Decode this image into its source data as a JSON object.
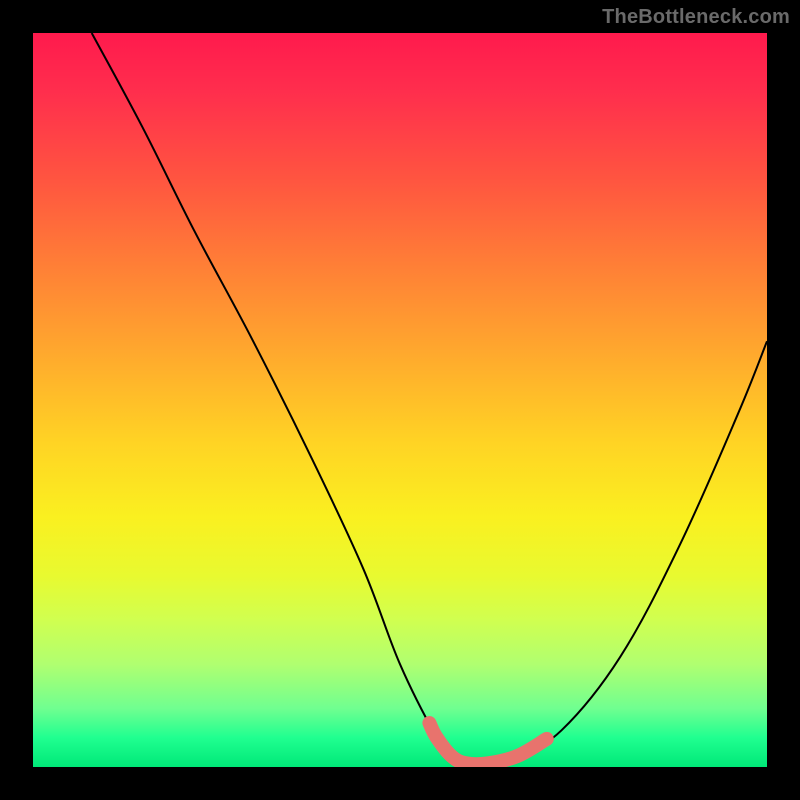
{
  "watermark": "TheBottleneck.com",
  "chart_data": {
    "type": "line",
    "title": "",
    "xlabel": "",
    "ylabel": "",
    "xlim": [
      0,
      100
    ],
    "ylim": [
      0,
      100
    ],
    "background": "heatmap-gradient",
    "series": [
      {
        "name": "curve",
        "x": [
          8,
          15,
          22,
          30,
          38,
          45,
          50,
          55,
          57,
          59,
          62,
          66,
          72,
          80,
          88,
          96,
          100
        ],
        "y": [
          100,
          87,
          73,
          58,
          42,
          27,
          14,
          4,
          1.5,
          0.5,
          0.5,
          1.5,
          5,
          15,
          30,
          48,
          58
        ]
      }
    ],
    "highlight": {
      "xrange": [
        54,
        70
      ],
      "color": "#e8736d"
    }
  }
}
